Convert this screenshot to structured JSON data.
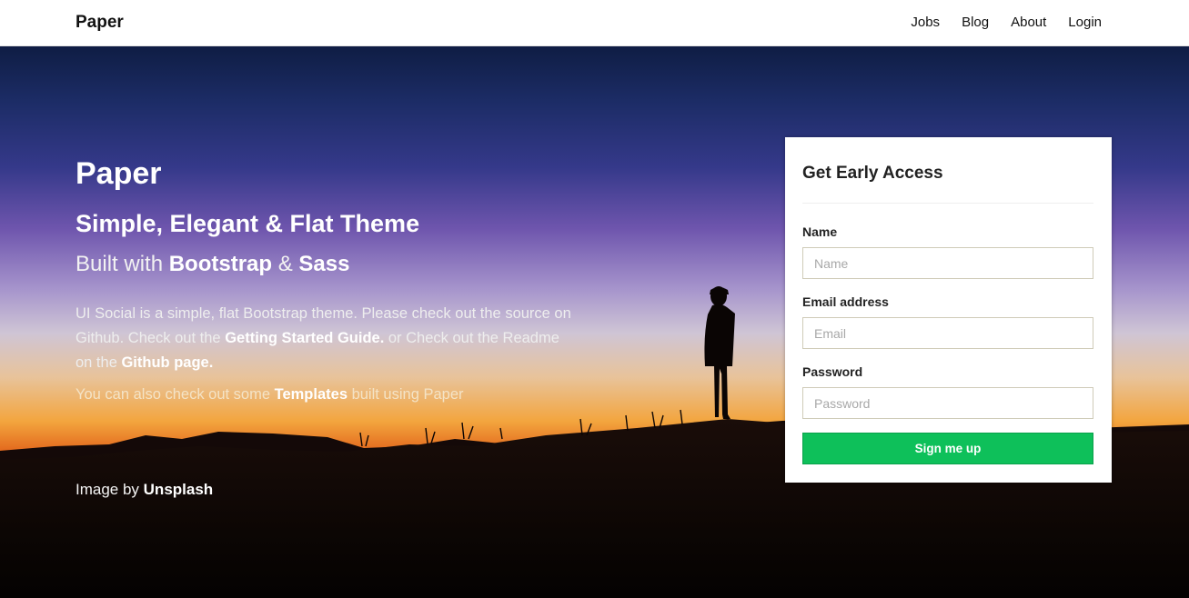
{
  "navbar": {
    "brand": "Paper",
    "links": [
      "Jobs",
      "Blog",
      "About",
      "Login"
    ]
  },
  "hero": {
    "title": "Paper",
    "subtitle": "Simple, Elegant & Flat Theme",
    "built": {
      "prefix": "Built with ",
      "bootstrap": "Bootstrap",
      "amp": " & ",
      "sass": "Sass"
    },
    "description": {
      "part1": "UI Social is a simple, flat Bootstrap theme. Please check out the source on Github. Check out the ",
      "link1": "Getting Started Guide.",
      "part2": " or Check out the Readme on the ",
      "link2": "Github page."
    },
    "templates": {
      "prefix": "You can also check out some ",
      "link": "Templates",
      "suffix": " built using Paper"
    },
    "credit": {
      "prefix": "Image by ",
      "link": "Unsplash"
    }
  },
  "form": {
    "title": "Get Early Access",
    "name_label": "Name",
    "name_placeholder": "Name",
    "email_label": "Email address",
    "email_placeholder": "Email",
    "password_label": "Password",
    "password_placeholder": "Password",
    "submit_label": "Sign me up"
  },
  "colors": {
    "accent": "#0ec05a"
  }
}
